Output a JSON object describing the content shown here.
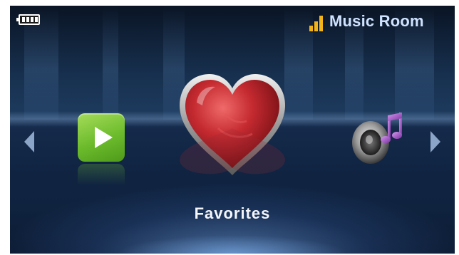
{
  "status_bar": {
    "title": "Music Room",
    "battery_icon": "battery-full-icon",
    "battery_level": 1.0,
    "signal_icon": "signal-bars-icon",
    "signal_bars": 3
  },
  "carousel": {
    "selected_label": "Favorites",
    "items": [
      {
        "icon": "play-icon"
      },
      {
        "icon": "heart-icon"
      },
      {
        "icon": "speaker-music-icon"
      }
    ],
    "prev_icon": "arrow-left-icon",
    "next_icon": "arrow-right-icon"
  },
  "colors": {
    "background": "#1d3a5d",
    "title": "#cfe3ff",
    "signal": "#f2b418",
    "play_tile": "#6cbb2c",
    "heart": "#b8222a",
    "arrow": "#8aa5c7"
  }
}
